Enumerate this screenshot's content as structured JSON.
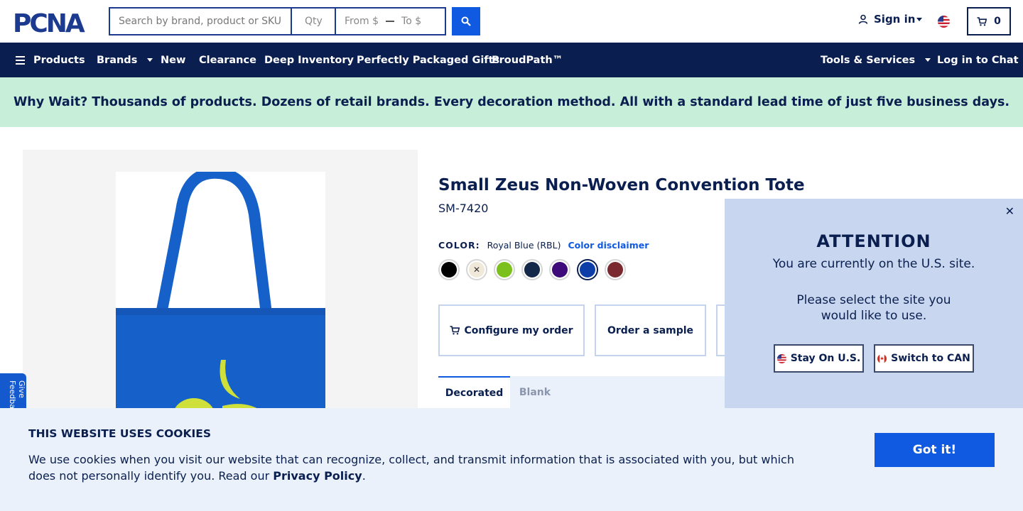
{
  "header": {
    "logo_text": "PCNA",
    "search_placeholder": "Search by brand, product or SKU",
    "qty_placeholder": "Qty",
    "price_from_placeholder": "From $",
    "price_to_placeholder": "To $",
    "signin_label": "Sign in",
    "cart_count": "0"
  },
  "nav": {
    "products": "Products",
    "brands": "Brands",
    "new": "New",
    "clearance": "Clearance",
    "deep_inventory": "Deep Inventory",
    "packaged_gifts": "Perfectly Packaged Gifts",
    "proudpath": "ProudPath™",
    "tools_services": "Tools & Services",
    "chat": "Log in to Chat"
  },
  "promo": {
    "text": "Why Wait? Thousands of products. Dozens of retail brands. Every decoration method. All with a standard lead time of just five business days."
  },
  "feedback_tab": "Give Feedback",
  "product": {
    "title": "Small Zeus Non-Woven Convention Tote",
    "sku": "SM-7420",
    "color_label": "COLOR:",
    "color_value": "Royal Blue (RBL)",
    "color_disclaimer": "Color disclaimer",
    "swatches": [
      {
        "color": "#000000"
      },
      {
        "color": "#f0e8d8",
        "mark": "✕"
      },
      {
        "color": "#7cc01e"
      },
      {
        "color": "#14284a"
      },
      {
        "color": "#3e0a7a"
      },
      {
        "color": "#0d3ea8",
        "selected": true
      },
      {
        "color": "#7a2a2e"
      }
    ],
    "actions": {
      "configure": "Configure my order",
      "sample": "Order a sample"
    },
    "tabs": {
      "decorated": "Decorated",
      "blank": "Blank"
    }
  },
  "attention": {
    "title": "ATTENTION",
    "line1": "You are currently on the U.S. site.",
    "line2": "Please select the site you would like to use.",
    "stay_us": "Stay On U.S.",
    "switch_can": "Switch to CAN"
  },
  "cookies": {
    "title": "THIS WEBSITE USES COOKIES",
    "text_before": "We use cookies when you visit our website that can recognize, collect, and transmit information that is associated with you, but which does not personally identify you. Read our ",
    "privacy_link": "Privacy Policy",
    "text_after": ".",
    "button": "Got it!"
  },
  "colors": {
    "navy": "#0a1f4f",
    "accent_blue": "#0f5ae0",
    "promo_green": "#c6eed8",
    "popup_blue": "#c8d7ef",
    "cookie_bg": "#eaf1fb",
    "bag_blue": "#1561c9",
    "logo_yellow": "#cfe03a"
  }
}
